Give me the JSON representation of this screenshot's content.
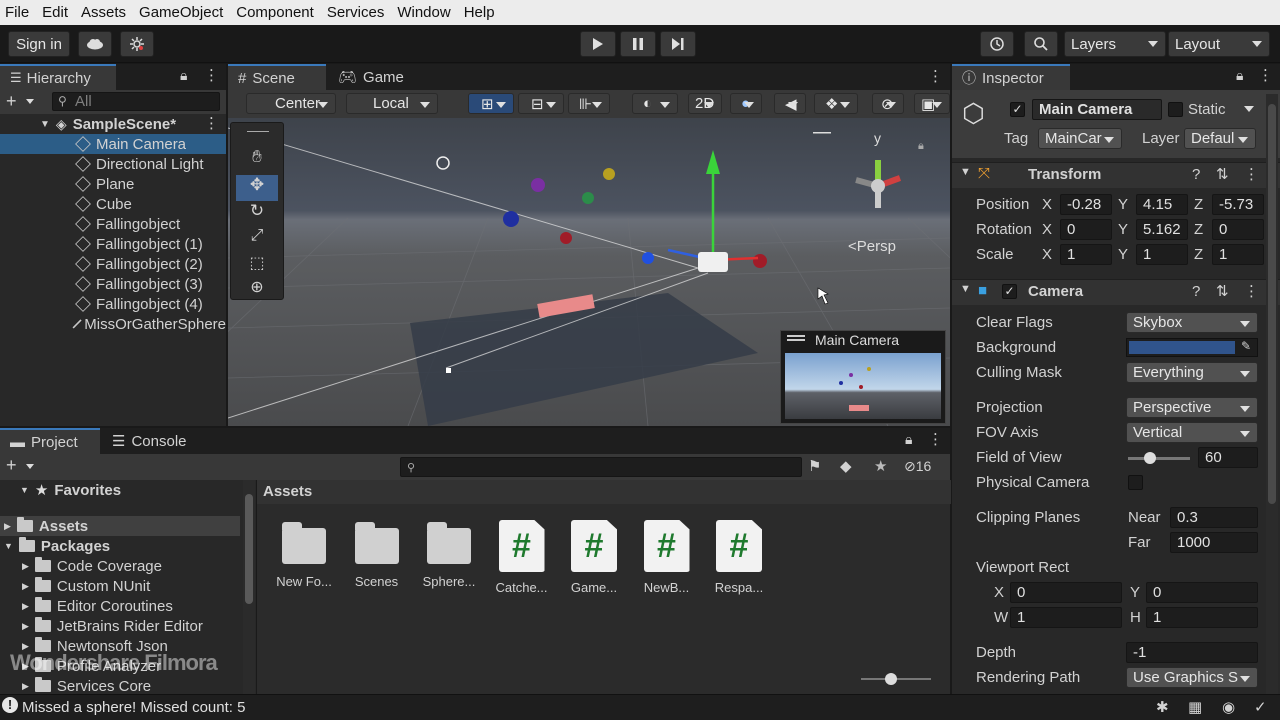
{
  "menu": [
    "File",
    "Edit",
    "Assets",
    "GameObject",
    "Component",
    "Services",
    "Window",
    "Help"
  ],
  "toolbar": {
    "sign_in": "Sign in",
    "layers": "Layers",
    "layout": "Layout"
  },
  "hierarchy": {
    "tab": "Hierarchy",
    "search_placeholder": "All",
    "scene": "SampleScene*",
    "items": [
      "Main Camera",
      "Directional Light",
      "Plane",
      "Cube",
      "Fallingobject",
      "Fallingobject (1)",
      "Fallingobject (2)",
      "Fallingobject (3)",
      "Fallingobject (4)",
      "MissOrGatherSphere"
    ]
  },
  "scene": {
    "tab_scene": "Scene",
    "tab_game": "Game",
    "pivot": "Center",
    "space": "Local",
    "mode_2d": "2D",
    "persp": "<Persp",
    "gizmo_y": "y",
    "cam_preview_title": "Main Camera"
  },
  "project": {
    "tab_project": "Project",
    "tab_console": "Console",
    "favorites": "Favorites",
    "assets": "Assets",
    "packages": "Packages",
    "package_items": [
      "Code Coverage",
      "Custom NUnit",
      "Editor Coroutines",
      "JetBrains Rider Editor",
      "Newtonsoft Json",
      "Profile Analyzer",
      "Services Core"
    ],
    "hidden_count": "16",
    "assets_header": "Assets",
    "asset_items": [
      {
        "name": "New Fo...",
        "kind": "folder"
      },
      {
        "name": "Scenes",
        "kind": "folder"
      },
      {
        "name": "Sphere...",
        "kind": "folder"
      },
      {
        "name": "Catche...",
        "kind": "script"
      },
      {
        "name": "Game...",
        "kind": "script"
      },
      {
        "name": "NewB...",
        "kind": "script"
      },
      {
        "name": "Respa...",
        "kind": "script"
      }
    ],
    "script_glyph": "#"
  },
  "inspector": {
    "tab": "Inspector",
    "object_name": "Main Camera",
    "static": "Static",
    "tag_label": "Tag",
    "tag": "MainCar",
    "layer_label": "Layer",
    "layer": "Defaul",
    "transform": {
      "title": "Transform",
      "position": "Position",
      "rotation": "Rotation",
      "scale": "Scale",
      "pos": [
        "-0.28",
        "4.15",
        "-5.73"
      ],
      "rot": [
        "0",
        "5.162",
        "0"
      ],
      "scl": [
        "1",
        "1",
        "1"
      ],
      "x": "X",
      "y": "Y",
      "z": "Z"
    },
    "camera": {
      "title": "Camera",
      "clear_flags_label": "Clear Flags",
      "clear_flags": "Skybox",
      "background_label": "Background",
      "culling_label": "Culling Mask",
      "culling": "Everything",
      "projection_label": "Projection",
      "projection": "Perspective",
      "fov_axis_label": "FOV Axis",
      "fov_axis": "Vertical",
      "fov_label": "Field of View",
      "fov": "60",
      "fov_fraction": 0.2,
      "physical_label": "Physical Camera",
      "clipping_label": "Clipping Planes",
      "near_label": "Near",
      "near": "0.3",
      "far_label": "Far",
      "far": "1000",
      "viewport_label": "Viewport Rect",
      "vx": "0",
      "vy": "0",
      "vw": "1",
      "vh": "1",
      "x": "X",
      "y": "Y",
      "w": "W",
      "h": "H",
      "depth_label": "Depth",
      "depth": "-1",
      "render_path_label": "Rendering Path",
      "render_path": "Use Graphics S"
    },
    "bg_color": "#30548c"
  },
  "status": {
    "message": "Missed a sphere! Missed count: 5"
  },
  "watermark": "Wondershare Filmora"
}
